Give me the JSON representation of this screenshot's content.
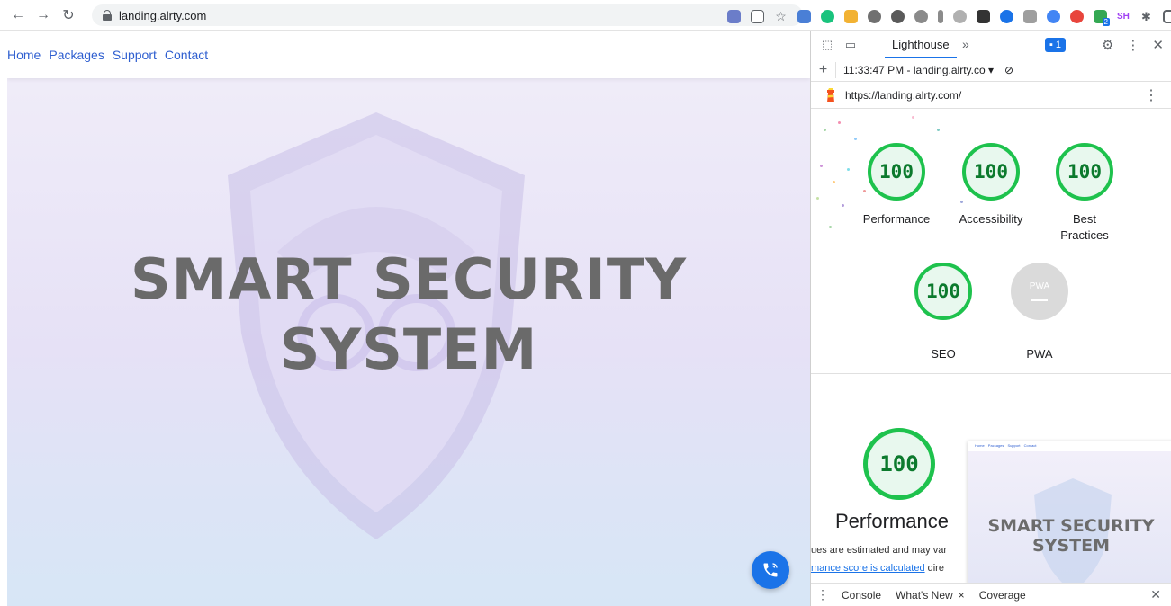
{
  "browser": {
    "url": "landing.alrty.com",
    "ext_sh": "SH",
    "ext_count": "2"
  },
  "page": {
    "nav": [
      "Home",
      "Packages",
      "Support",
      "Contact"
    ],
    "hero_line1": "SMART SECURITY",
    "hero_line2": "SYSTEM"
  },
  "devtools": {
    "tab": "Lighthouse",
    "more_tabs": "»",
    "issues_count": "1",
    "report_select": "11:33:47 PM - landing.alrty.co",
    "report_url": "https://landing.alrty.com/",
    "scores": [
      {
        "label": "Performance",
        "value": "100"
      },
      {
        "label": "Accessibility",
        "value": "100"
      },
      {
        "label": "Best Practices",
        "value": "100"
      },
      {
        "label": "SEO",
        "value": "100"
      }
    ],
    "pwa_label": "PWA",
    "pwa_badge": "PWA",
    "perf_score": "100",
    "perf_title": "Performance",
    "perf_note": "ues are estimated and may var",
    "perf_link": "mance score is calculated",
    "perf_link_suffix": " dire",
    "thumbnail": {
      "nav": [
        "Home",
        "Packages",
        "Support",
        "Contact"
      ],
      "hero_line1": "SMART SECURITY",
      "hero_line2": "SYSTEM"
    },
    "drawer": {
      "tabs": [
        "Console",
        "What's New",
        "Coverage"
      ]
    }
  },
  "colors": {
    "score_green": "#1ec24d",
    "link_blue": "#2f5fd0",
    "call_button": "#1a73e8"
  }
}
